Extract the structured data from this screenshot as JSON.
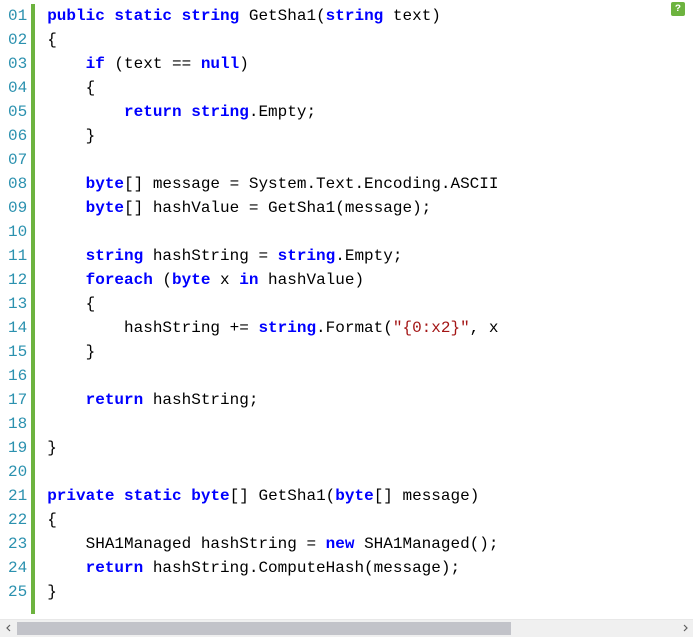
{
  "help_badge": "?",
  "lines": [
    {
      "num": "01",
      "tokens": [
        {
          "t": "kw",
          "v": "public"
        },
        {
          "t": "plain",
          "v": " "
        },
        {
          "t": "kw",
          "v": "static"
        },
        {
          "t": "plain",
          "v": " "
        },
        {
          "t": "type",
          "v": "string"
        },
        {
          "t": "plain",
          "v": " GetSha1("
        },
        {
          "t": "type",
          "v": "string"
        },
        {
          "t": "plain",
          "v": " text)"
        }
      ],
      "indent": 0
    },
    {
      "num": "02",
      "tokens": [
        {
          "t": "plain",
          "v": "{"
        }
      ],
      "indent": 0
    },
    {
      "num": "03",
      "tokens": [
        {
          "t": "kw",
          "v": "if"
        },
        {
          "t": "plain",
          "v": " (text == "
        },
        {
          "t": "kw",
          "v": "null"
        },
        {
          "t": "plain",
          "v": ")"
        }
      ],
      "indent": 1
    },
    {
      "num": "04",
      "tokens": [
        {
          "t": "plain",
          "v": "{"
        }
      ],
      "indent": 1
    },
    {
      "num": "05",
      "tokens": [
        {
          "t": "kw",
          "v": "return"
        },
        {
          "t": "plain",
          "v": " "
        },
        {
          "t": "type",
          "v": "string"
        },
        {
          "t": "plain",
          "v": ".Empty;"
        }
      ],
      "indent": 2
    },
    {
      "num": "06",
      "tokens": [
        {
          "t": "plain",
          "v": "}"
        }
      ],
      "indent": 1
    },
    {
      "num": "07",
      "tokens": [],
      "indent": 0
    },
    {
      "num": "08",
      "tokens": [
        {
          "t": "type",
          "v": "byte"
        },
        {
          "t": "plain",
          "v": "[] message = System.Text.Encoding.ASCII"
        }
      ],
      "indent": 1
    },
    {
      "num": "09",
      "tokens": [
        {
          "t": "type",
          "v": "byte"
        },
        {
          "t": "plain",
          "v": "[] hashValue = GetSha1(message);"
        }
      ],
      "indent": 1
    },
    {
      "num": "10",
      "tokens": [],
      "indent": 0
    },
    {
      "num": "11",
      "tokens": [
        {
          "t": "type",
          "v": "string"
        },
        {
          "t": "plain",
          "v": " hashString = "
        },
        {
          "t": "type",
          "v": "string"
        },
        {
          "t": "plain",
          "v": ".Empty;"
        }
      ],
      "indent": 1
    },
    {
      "num": "12",
      "tokens": [
        {
          "t": "kw",
          "v": "foreach"
        },
        {
          "t": "plain",
          "v": " ("
        },
        {
          "t": "type",
          "v": "byte"
        },
        {
          "t": "plain",
          "v": " x "
        },
        {
          "t": "kw",
          "v": "in"
        },
        {
          "t": "plain",
          "v": " hashValue)"
        }
      ],
      "indent": 1
    },
    {
      "num": "13",
      "tokens": [
        {
          "t": "plain",
          "v": "{"
        }
      ],
      "indent": 1
    },
    {
      "num": "14",
      "tokens": [
        {
          "t": "plain",
          "v": "hashString += "
        },
        {
          "t": "type",
          "v": "string"
        },
        {
          "t": "plain",
          "v": ".Format("
        },
        {
          "t": "str",
          "v": "\"{0:x2}\""
        },
        {
          "t": "plain",
          "v": ", x"
        }
      ],
      "indent": 2
    },
    {
      "num": "15",
      "tokens": [
        {
          "t": "plain",
          "v": "}"
        }
      ],
      "indent": 1
    },
    {
      "num": "16",
      "tokens": [],
      "indent": 0
    },
    {
      "num": "17",
      "tokens": [
        {
          "t": "kw",
          "v": "return"
        },
        {
          "t": "plain",
          "v": " hashString;"
        }
      ],
      "indent": 1
    },
    {
      "num": "18",
      "tokens": [],
      "indent": 0
    },
    {
      "num": "19",
      "tokens": [
        {
          "t": "plain",
          "v": "}"
        }
      ],
      "indent": 0
    },
    {
      "num": "20",
      "tokens": [],
      "indent": 0
    },
    {
      "num": "21",
      "tokens": [
        {
          "t": "kw",
          "v": "private"
        },
        {
          "t": "plain",
          "v": " "
        },
        {
          "t": "kw",
          "v": "static"
        },
        {
          "t": "plain",
          "v": " "
        },
        {
          "t": "type",
          "v": "byte"
        },
        {
          "t": "plain",
          "v": "[] GetSha1("
        },
        {
          "t": "type",
          "v": "byte"
        },
        {
          "t": "plain",
          "v": "[] message)"
        }
      ],
      "indent": 0
    },
    {
      "num": "22",
      "tokens": [
        {
          "t": "plain",
          "v": "{"
        }
      ],
      "indent": 0
    },
    {
      "num": "23",
      "tokens": [
        {
          "t": "plain",
          "v": "SHA1Managed hashString = "
        },
        {
          "t": "kw",
          "v": "new"
        },
        {
          "t": "plain",
          "v": " SHA1Managed();"
        }
      ],
      "indent": 1
    },
    {
      "num": "24",
      "tokens": [
        {
          "t": "kw",
          "v": "return"
        },
        {
          "t": "plain",
          "v": " hashString.ComputeHash(message);"
        }
      ],
      "indent": 1
    },
    {
      "num": "25",
      "tokens": [
        {
          "t": "plain",
          "v": "}"
        }
      ],
      "indent": 0
    }
  ],
  "indent_string": "    "
}
